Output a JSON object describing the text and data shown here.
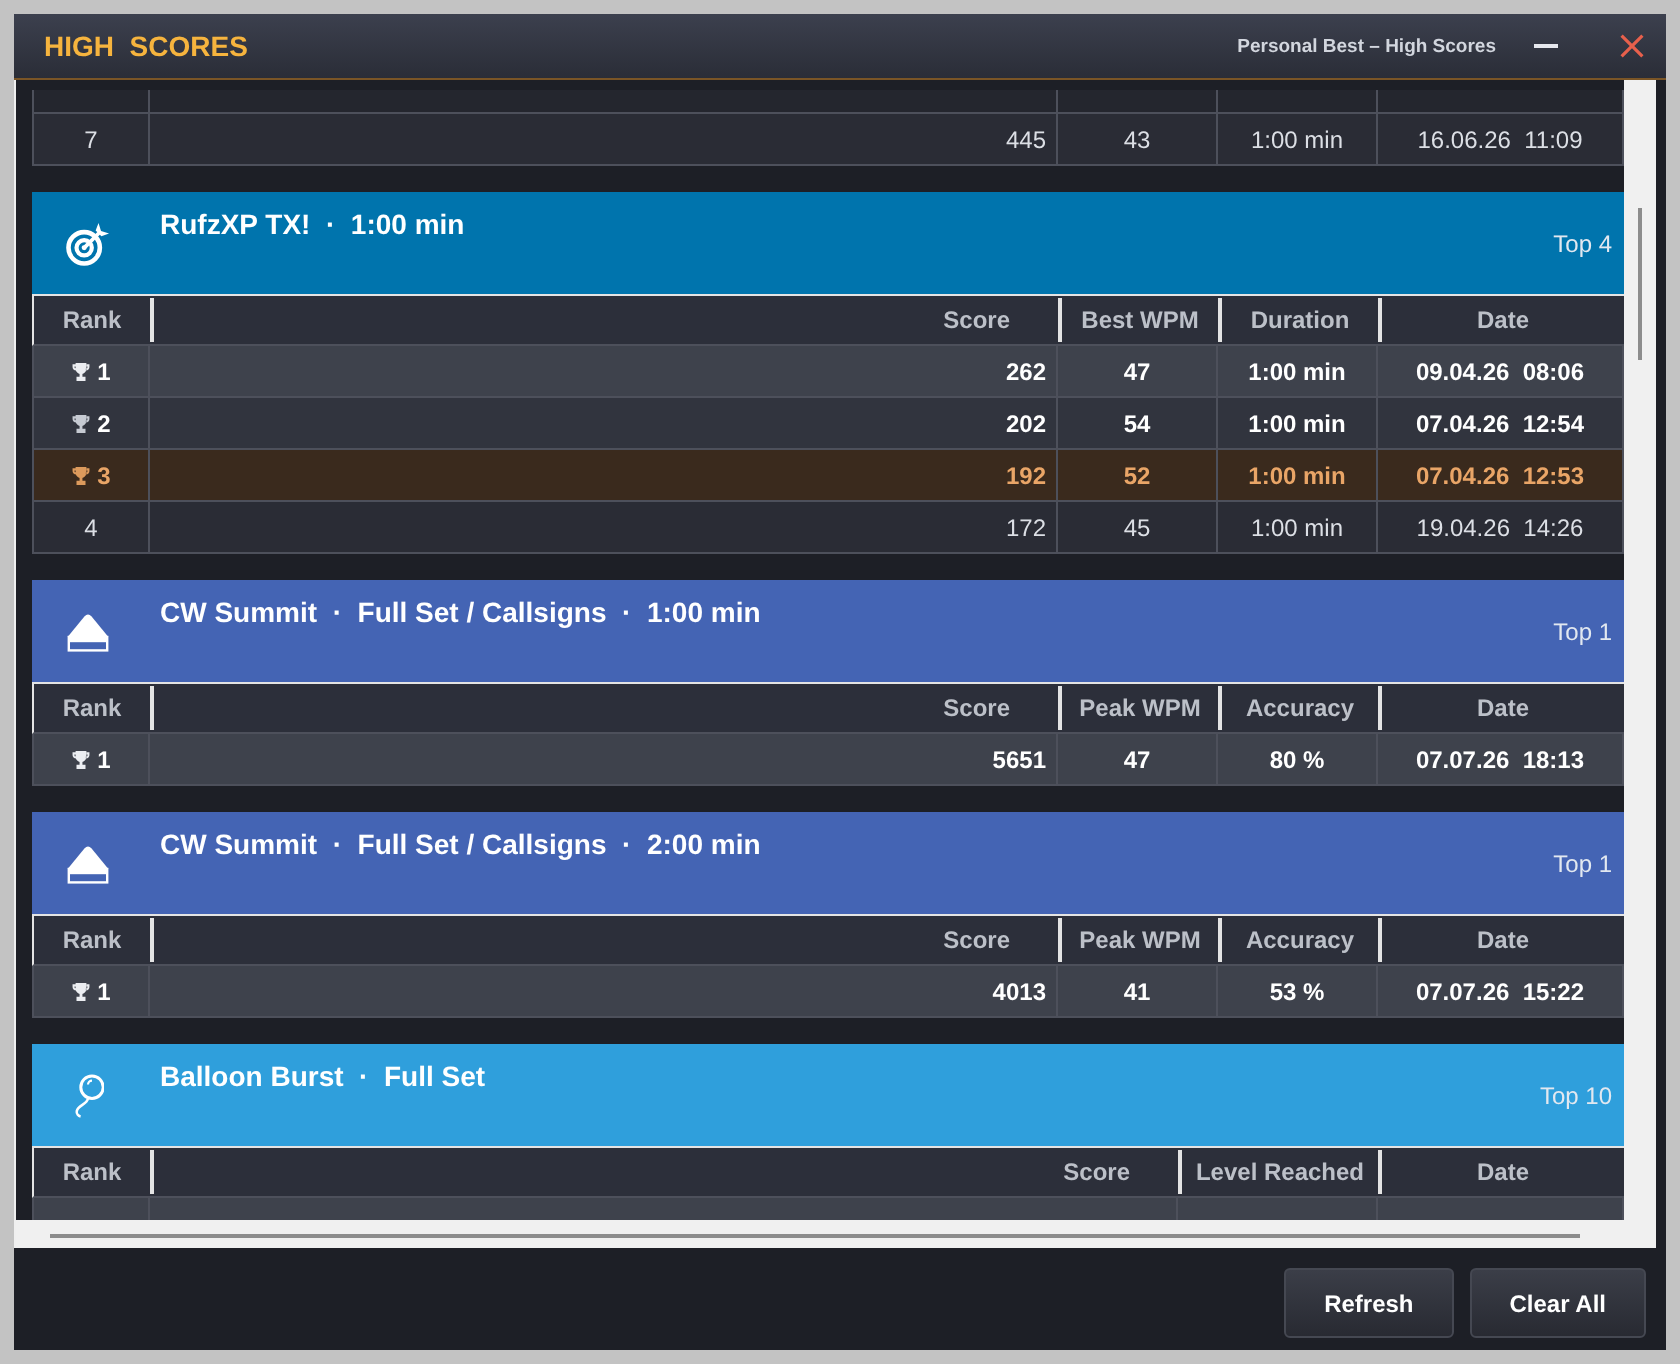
{
  "window": {
    "title": "HIGH  SCORES",
    "subtitle": "Personal Best – High Scores"
  },
  "partial_table": {
    "rows": [
      {
        "kind": "plain",
        "cells": [
          "7",
          "445",
          "43",
          "1:00 min",
          "16.06.26  11:09"
        ]
      }
    ]
  },
  "sections": [
    {
      "kind": "target",
      "color": "#0074ad",
      "title": "RufzXP TX!  ·  1:00 min",
      "top": "Top 4",
      "columns": [
        "Rank",
        "Score",
        "Best WPM",
        "Duration",
        "Date"
      ],
      "rows": [
        {
          "kind": "first",
          "cells": [
            "1",
            "262",
            "47",
            "1:00 min",
            "09.04.26  08:06"
          ]
        },
        {
          "kind": "second",
          "cells": [
            "2",
            "202",
            "54",
            "1:00 min",
            "07.04.26  12:54"
          ]
        },
        {
          "kind": "third",
          "cells": [
            "3",
            "192",
            "52",
            "1:00 min",
            "07.04.26  12:53"
          ]
        },
        {
          "kind": "plain",
          "cells": [
            "4",
            "172",
            "45",
            "1:00 min",
            "19.04.26  14:26"
          ]
        }
      ]
    },
    {
      "kind": "dome",
      "color": "#4464b4",
      "title": "CW Summit  ·  Full Set / Callsigns  ·  1:00 min",
      "top": "Top 1",
      "columns": [
        "Rank",
        "Score",
        "Peak WPM",
        "Accuracy",
        "Date"
      ],
      "rows": [
        {
          "kind": "first",
          "cells": [
            "1",
            "5651",
            "47",
            "80 %",
            "07.07.26  18:13"
          ]
        }
      ]
    },
    {
      "kind": "dome",
      "color": "#4464b4",
      "title": "CW Summit  ·  Full Set / Callsigns  ·  2:00 min",
      "top": "Top 1",
      "columns": [
        "Rank",
        "Score",
        "Peak WPM",
        "Accuracy",
        "Date"
      ],
      "rows": [
        {
          "kind": "first",
          "cells": [
            "1",
            "4013",
            "41",
            "53 %",
            "07.07.26  15:22"
          ]
        }
      ]
    },
    {
      "kind": "balloon",
      "color": "#2f9fdc",
      "title": "Balloon Burst  ·  Full Set",
      "top": "Top 10",
      "columns": [
        "Rank",
        "Score",
        "Level Reached",
        "Date"
      ]
    }
  ],
  "buttons": [
    "Refresh",
    "Clear All"
  ]
}
